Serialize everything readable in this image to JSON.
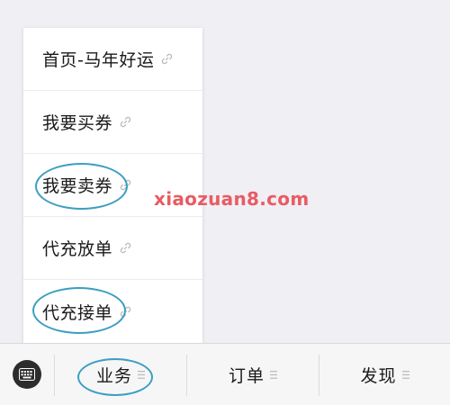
{
  "popup_menu": {
    "items": [
      {
        "label": "首页-马年好运",
        "icon": "link-icon",
        "circled": false
      },
      {
        "label": "我要买券",
        "icon": "link-icon",
        "circled": false
      },
      {
        "label": "我要卖券",
        "icon": "link-icon",
        "circled": true
      },
      {
        "label": "代充放单",
        "icon": "link-icon",
        "circled": false
      },
      {
        "label": "代充接单",
        "icon": "link-icon",
        "circled": true
      }
    ]
  },
  "watermark": {
    "text": "xiaozuan8.com",
    "color": "#e95b63"
  },
  "bottom_bar": {
    "keyboard_icon": "keyboard-icon",
    "tabs": [
      {
        "label": "业务",
        "icon": "menu-lines-icon",
        "circled": true
      },
      {
        "label": "订单",
        "icon": "menu-lines-icon",
        "circled": false
      },
      {
        "label": "发现",
        "icon": "menu-lines-icon",
        "circled": false
      }
    ]
  },
  "colors": {
    "background": "#efeff4",
    "highlight_oval": "#3c9fc1",
    "text": "#1a1a1a",
    "keyboard_button": "#2c2c2c"
  }
}
